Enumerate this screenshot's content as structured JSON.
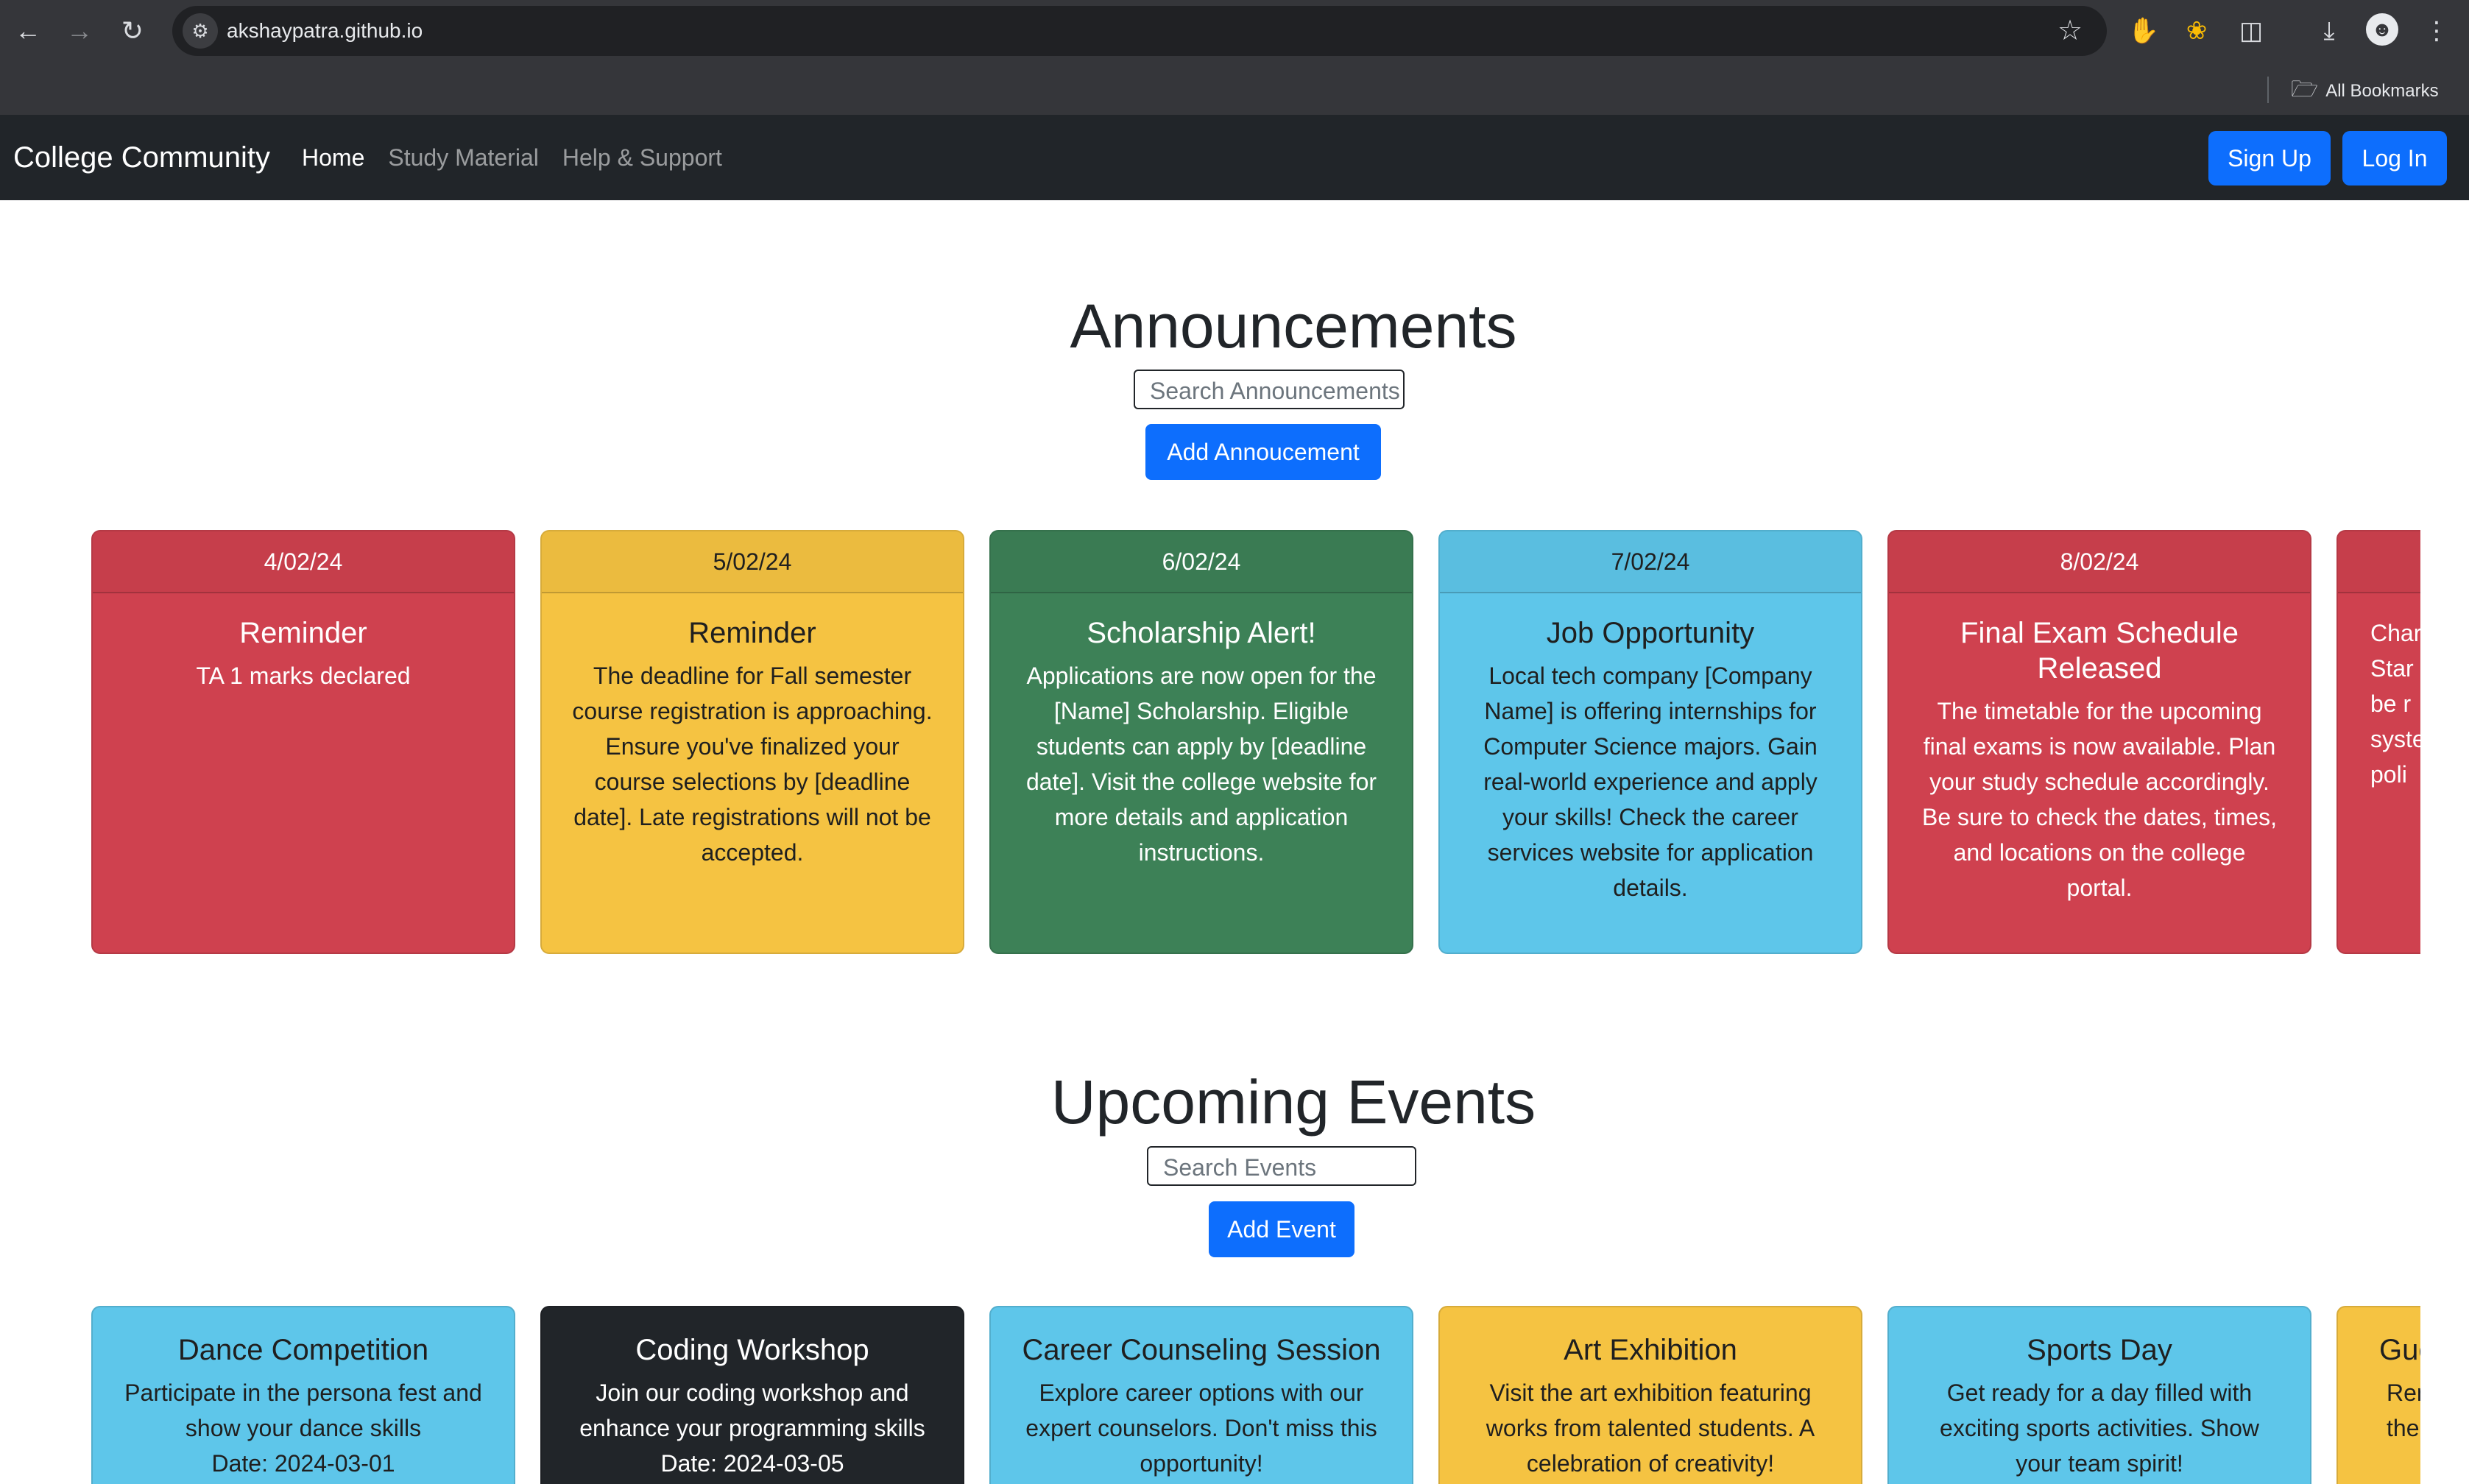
{
  "browser": {
    "url": "akshaypatra.github.io",
    "bookmarks_label": "All Bookmarks"
  },
  "navbar": {
    "brand": "College Community",
    "links": [
      "Home",
      "Study Material",
      "Help & Support"
    ],
    "active_link": "Home",
    "signup_label": "Sign Up",
    "login_label": "Log In"
  },
  "announcements": {
    "title": "Announcements",
    "search_placeholder": "Search Announcements",
    "add_label": "Add Annoucement",
    "items": [
      {
        "date": "4/02/24",
        "title": "Reminder",
        "text": "TA 1 marks declared",
        "color": "#cf414f"
      },
      {
        "date": "5/02/24",
        "title": "Reminder",
        "text": "The deadline for Fall semester\ncourse registration is approaching.\nEnsure you've finalized your\ncourse selections by [deadline\ndate]. Late registrations will not be\naccepted.",
        "color": "#f5c342"
      },
      {
        "date": "6/02/24",
        "title": "Scholarship Alert!",
        "text": "Applications are now open for the\n[Name] Scholarship. Eligible\nstudents can apply by [deadline\ndate]. Visit the college website for\nmore details and application\ninstructions.",
        "color": "#3d8157"
      },
      {
        "date": "7/02/24",
        "title": "Job Opportunity",
        "text": "Local tech company [Company\nName] is offering internships for\nComputer Science majors. Gain\nreal-world experience and apply\nyour skills! Check the career\nservices website for application\ndetails.",
        "color": "#5ec6ea"
      },
      {
        "date": "8/02/24",
        "title": "Final Exam Schedule\nReleased",
        "text": "The timetable for the upcoming\nfinal exams is now available. Plan\nyour study schedule accordingly.\nBe sure to check the dates, times,\nand locations on the college\nportal.",
        "color": "#cf414f"
      },
      {
        "date": "",
        "title": "",
        "text": "Char\nStar\nbe r\nsyste\npoli",
        "color": "#cf414f"
      }
    ]
  },
  "events": {
    "title": "Upcoming Events",
    "search_placeholder": "Search Events",
    "add_label": "Add Event",
    "items": [
      {
        "title": "Dance Competition",
        "text": "Participate in the persona fest and\nshow your dance skills\nDate: 2024-03-01",
        "color": "#5ec6ea"
      },
      {
        "title": "Coding Workshop",
        "text": "Join our coding workshop and\nenhance your programming skills\nDate: 2024-03-05",
        "color": "#212529"
      },
      {
        "title": "Career Counseling Session",
        "text": "Explore career options with our\nexpert counselors. Don't miss this\nopportunity!",
        "color": "#5ec6ea"
      },
      {
        "title": "Art Exhibition",
        "text": "Visit the art exhibition featuring\nworks from talented students. A\ncelebration of creativity!",
        "color": "#f5c342"
      },
      {
        "title": "Sports Day",
        "text": "Get ready for a day filled with\nexciting sports activities. Show\nyour team spirit!",
        "color": "#5ec6ea"
      },
      {
        "title": "Gue",
        "text": "Rem\nthei",
        "color": "#f5c342"
      }
    ]
  }
}
